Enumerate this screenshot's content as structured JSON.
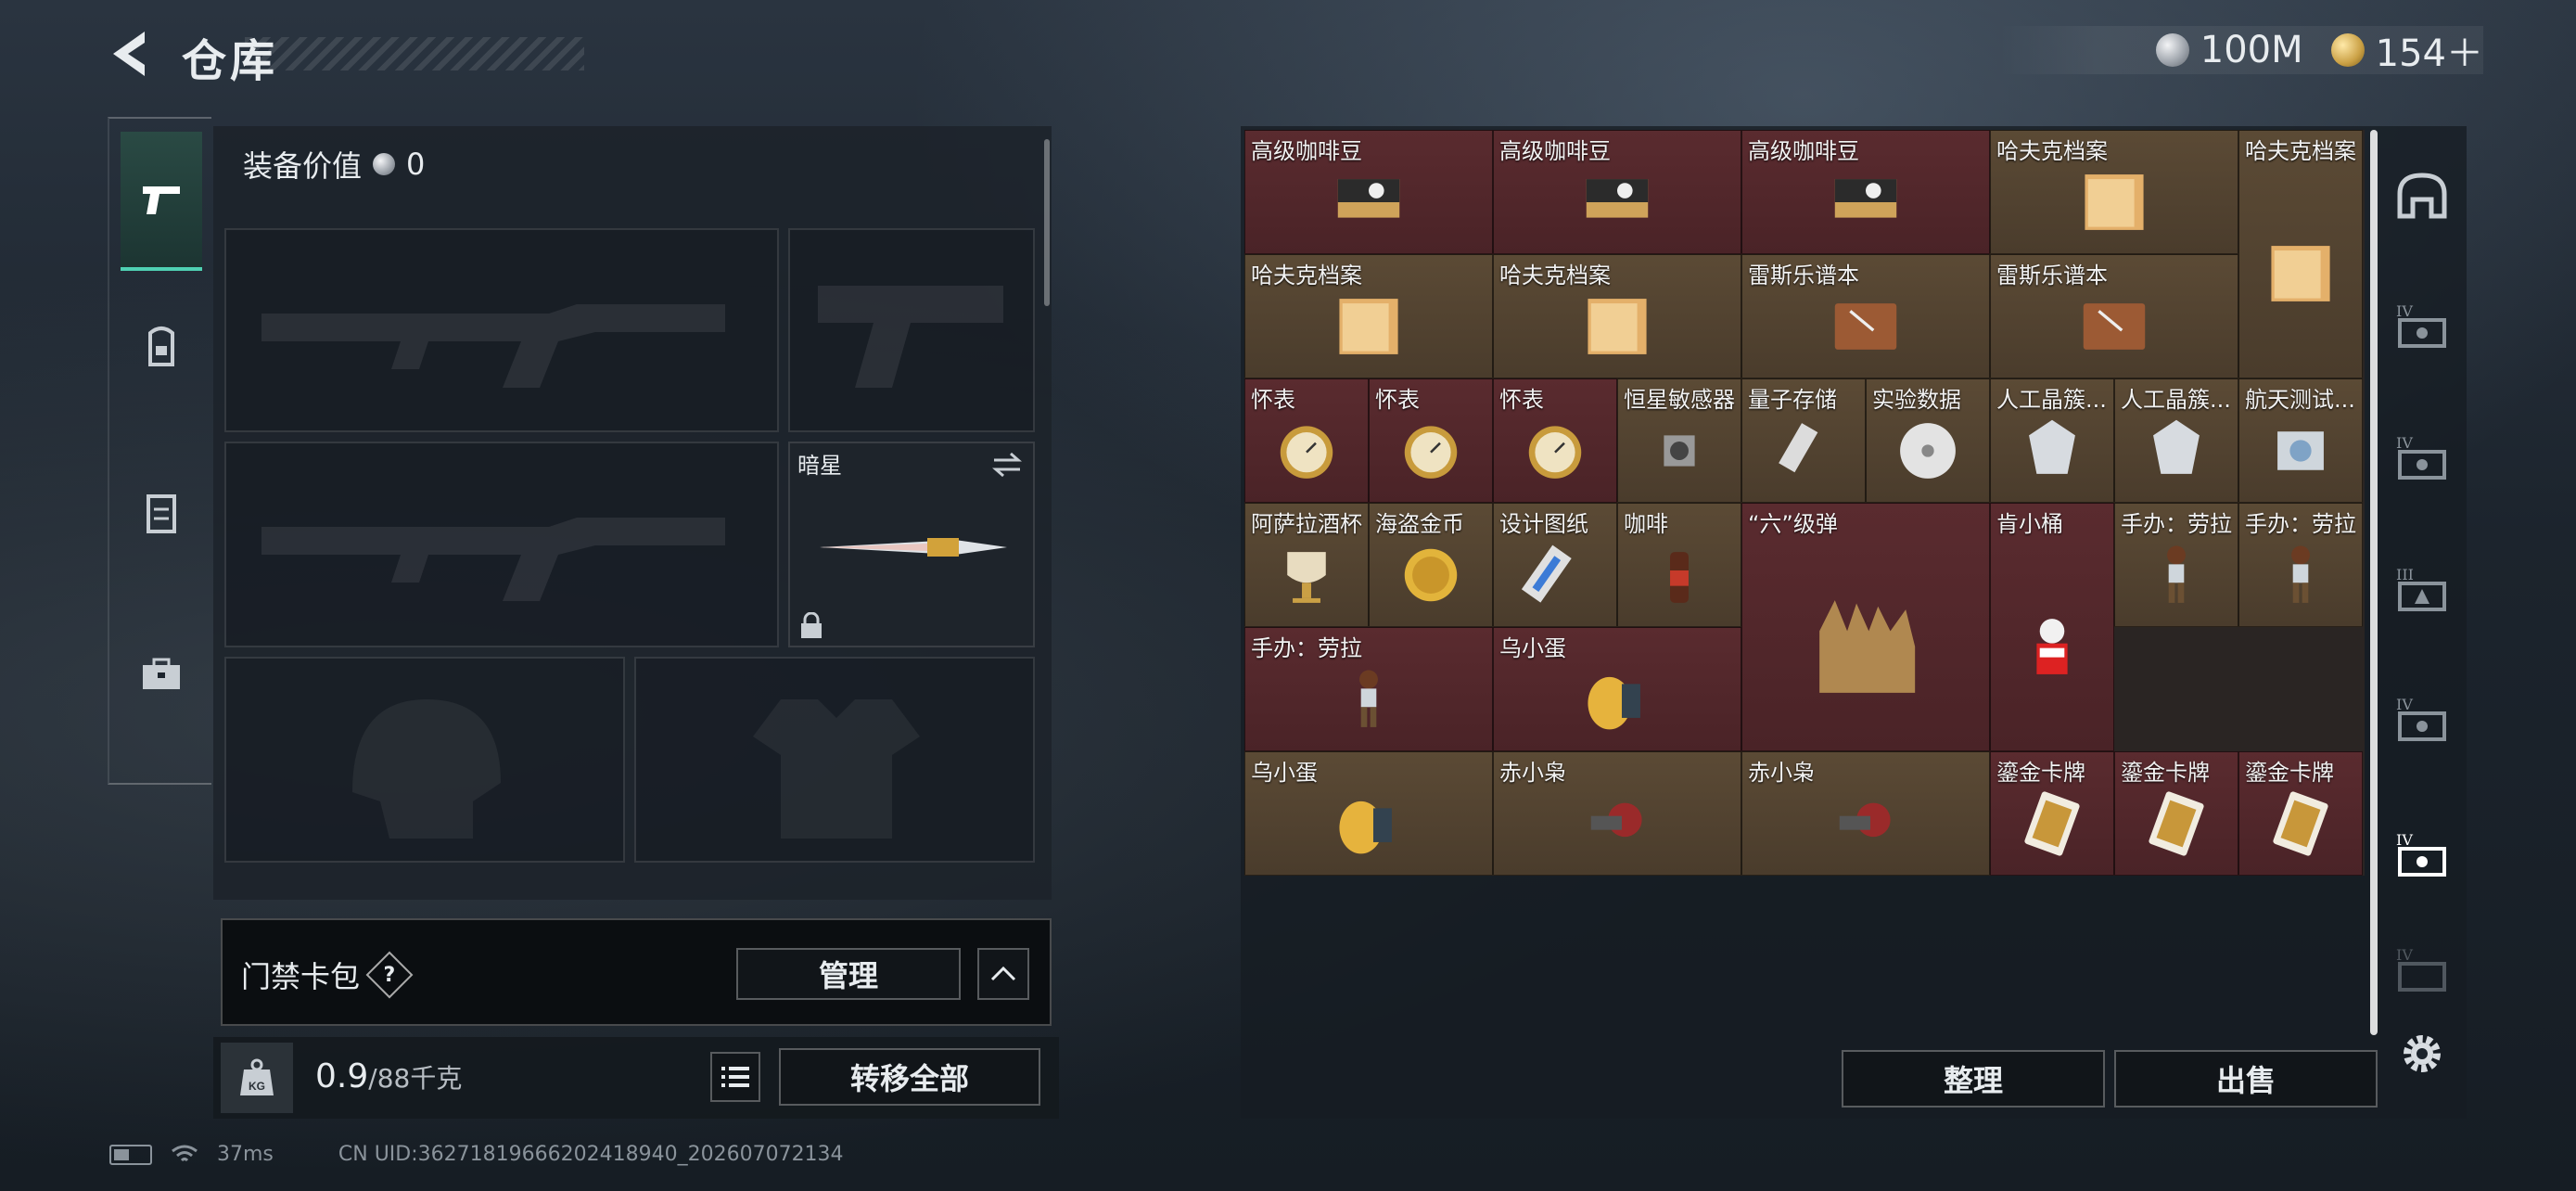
{
  "header": {
    "title": "仓库"
  },
  "currency": {
    "silver": "100M",
    "gold": "154＋"
  },
  "left_nav": [
    "pistol-icon",
    "backpack-icon",
    "vest-icon",
    "briefcase-icon"
  ],
  "equipment": {
    "value_label": "装备价值",
    "value": "0",
    "melee_slot_label": "暗星"
  },
  "keycard": {
    "label": "门禁卡包",
    "help": "?",
    "manage_label": "管理"
  },
  "weight": {
    "current": "0.9",
    "capacity": "/88千克",
    "kg_badge": "KG"
  },
  "transfer_label": "转移全部",
  "status": {
    "ping": "37ms",
    "uid": "CN UID:3627181966620241894​0_202607072134"
  },
  "storage": {
    "sort_label": "整理",
    "sell_label": "出售",
    "items": [
      {
        "label": "高级咖啡豆",
        "icon": "coffee-bag-icon"
      },
      {
        "label": "高级咖啡豆",
        "icon": "coffee-bag-icon"
      },
      {
        "label": "高级咖啡豆",
        "icon": "coffee-bag-icon"
      },
      {
        "label": "哈夫克档案",
        "icon": "folder-icon"
      },
      {
        "label": "哈夫克档案",
        "icon": "folder-icon"
      },
      {
        "label": "哈夫克档案",
        "icon": "folder-icon"
      },
      {
        "label": "哈夫克档案",
        "icon": "folder-icon"
      },
      {
        "label": "雷斯乐谱本",
        "icon": "leather-book-icon"
      },
      {
        "label": "雷斯乐谱本",
        "icon": "leather-book-icon"
      },
      {
        "label": "怀表",
        "icon": "pocket-watch-icon"
      },
      {
        "label": "怀表",
        "icon": "pocket-watch-icon"
      },
      {
        "label": "怀表",
        "icon": "pocket-watch-icon"
      },
      {
        "label": "恒星敏感器",
        "icon": "star-sensor-icon"
      },
      {
        "label": "量子存储",
        "icon": "usb-drive-icon"
      },
      {
        "label": "实验数据",
        "icon": "disc-icon"
      },
      {
        "label": "人工晶簇...",
        "icon": "crystal-icon"
      },
      {
        "label": "人工晶簇...",
        "icon": "crystal-icon"
      },
      {
        "label": "航天测试...",
        "icon": "space-device-icon"
      },
      {
        "label": "阿萨拉酒杯",
        "icon": "goblet-icon"
      },
      {
        "label": "海盗金币",
        "icon": "gold-coin-icon"
      },
      {
        "label": "设计图纸",
        "icon": "blueprint-icon"
      },
      {
        "label": "咖啡",
        "icon": "coffee-bottle-icon"
      },
      {
        "label": "“六”级弹",
        "icon": "bullets-hand-icon"
      },
      {
        "label": "肯小桶",
        "icon": "colonel-figure-icon"
      },
      {
        "label": "手办：劳拉",
        "icon": "lara-figure-icon"
      },
      {
        "label": "手办：劳拉",
        "icon": "lara-figure-icon"
      },
      {
        "label": "手办：劳拉",
        "icon": "lara-figure-icon"
      },
      {
        "label": "乌小蛋",
        "icon": "egg-figure-icon"
      },
      {
        "label": "乌小蛋",
        "icon": "egg-figure-icon"
      },
      {
        "label": "赤小枭",
        "icon": "owl-figure-icon"
      },
      {
        "label": "赤小枭",
        "icon": "owl-figure-icon"
      },
      {
        "label": "鎏金卡牌",
        "icon": "gold-card-icon"
      },
      {
        "label": "鎏金卡牌",
        "icon": "gold-card-icon"
      },
      {
        "label": "鎏金卡牌",
        "icon": "gold-card-icon"
      }
    ]
  },
  "right_tabs": [
    "helmet-tab-icon",
    "tier4-case-icon",
    "tier4-case-icon",
    "tier3-case-icon",
    "tier4-case-icon",
    "tier4-case-icon-active",
    "tier4-case-icon"
  ],
  "colors": {
    "accent": "#4fd1b3",
    "gold_cell": "#4f4030",
    "red_cell": "#52272b"
  }
}
